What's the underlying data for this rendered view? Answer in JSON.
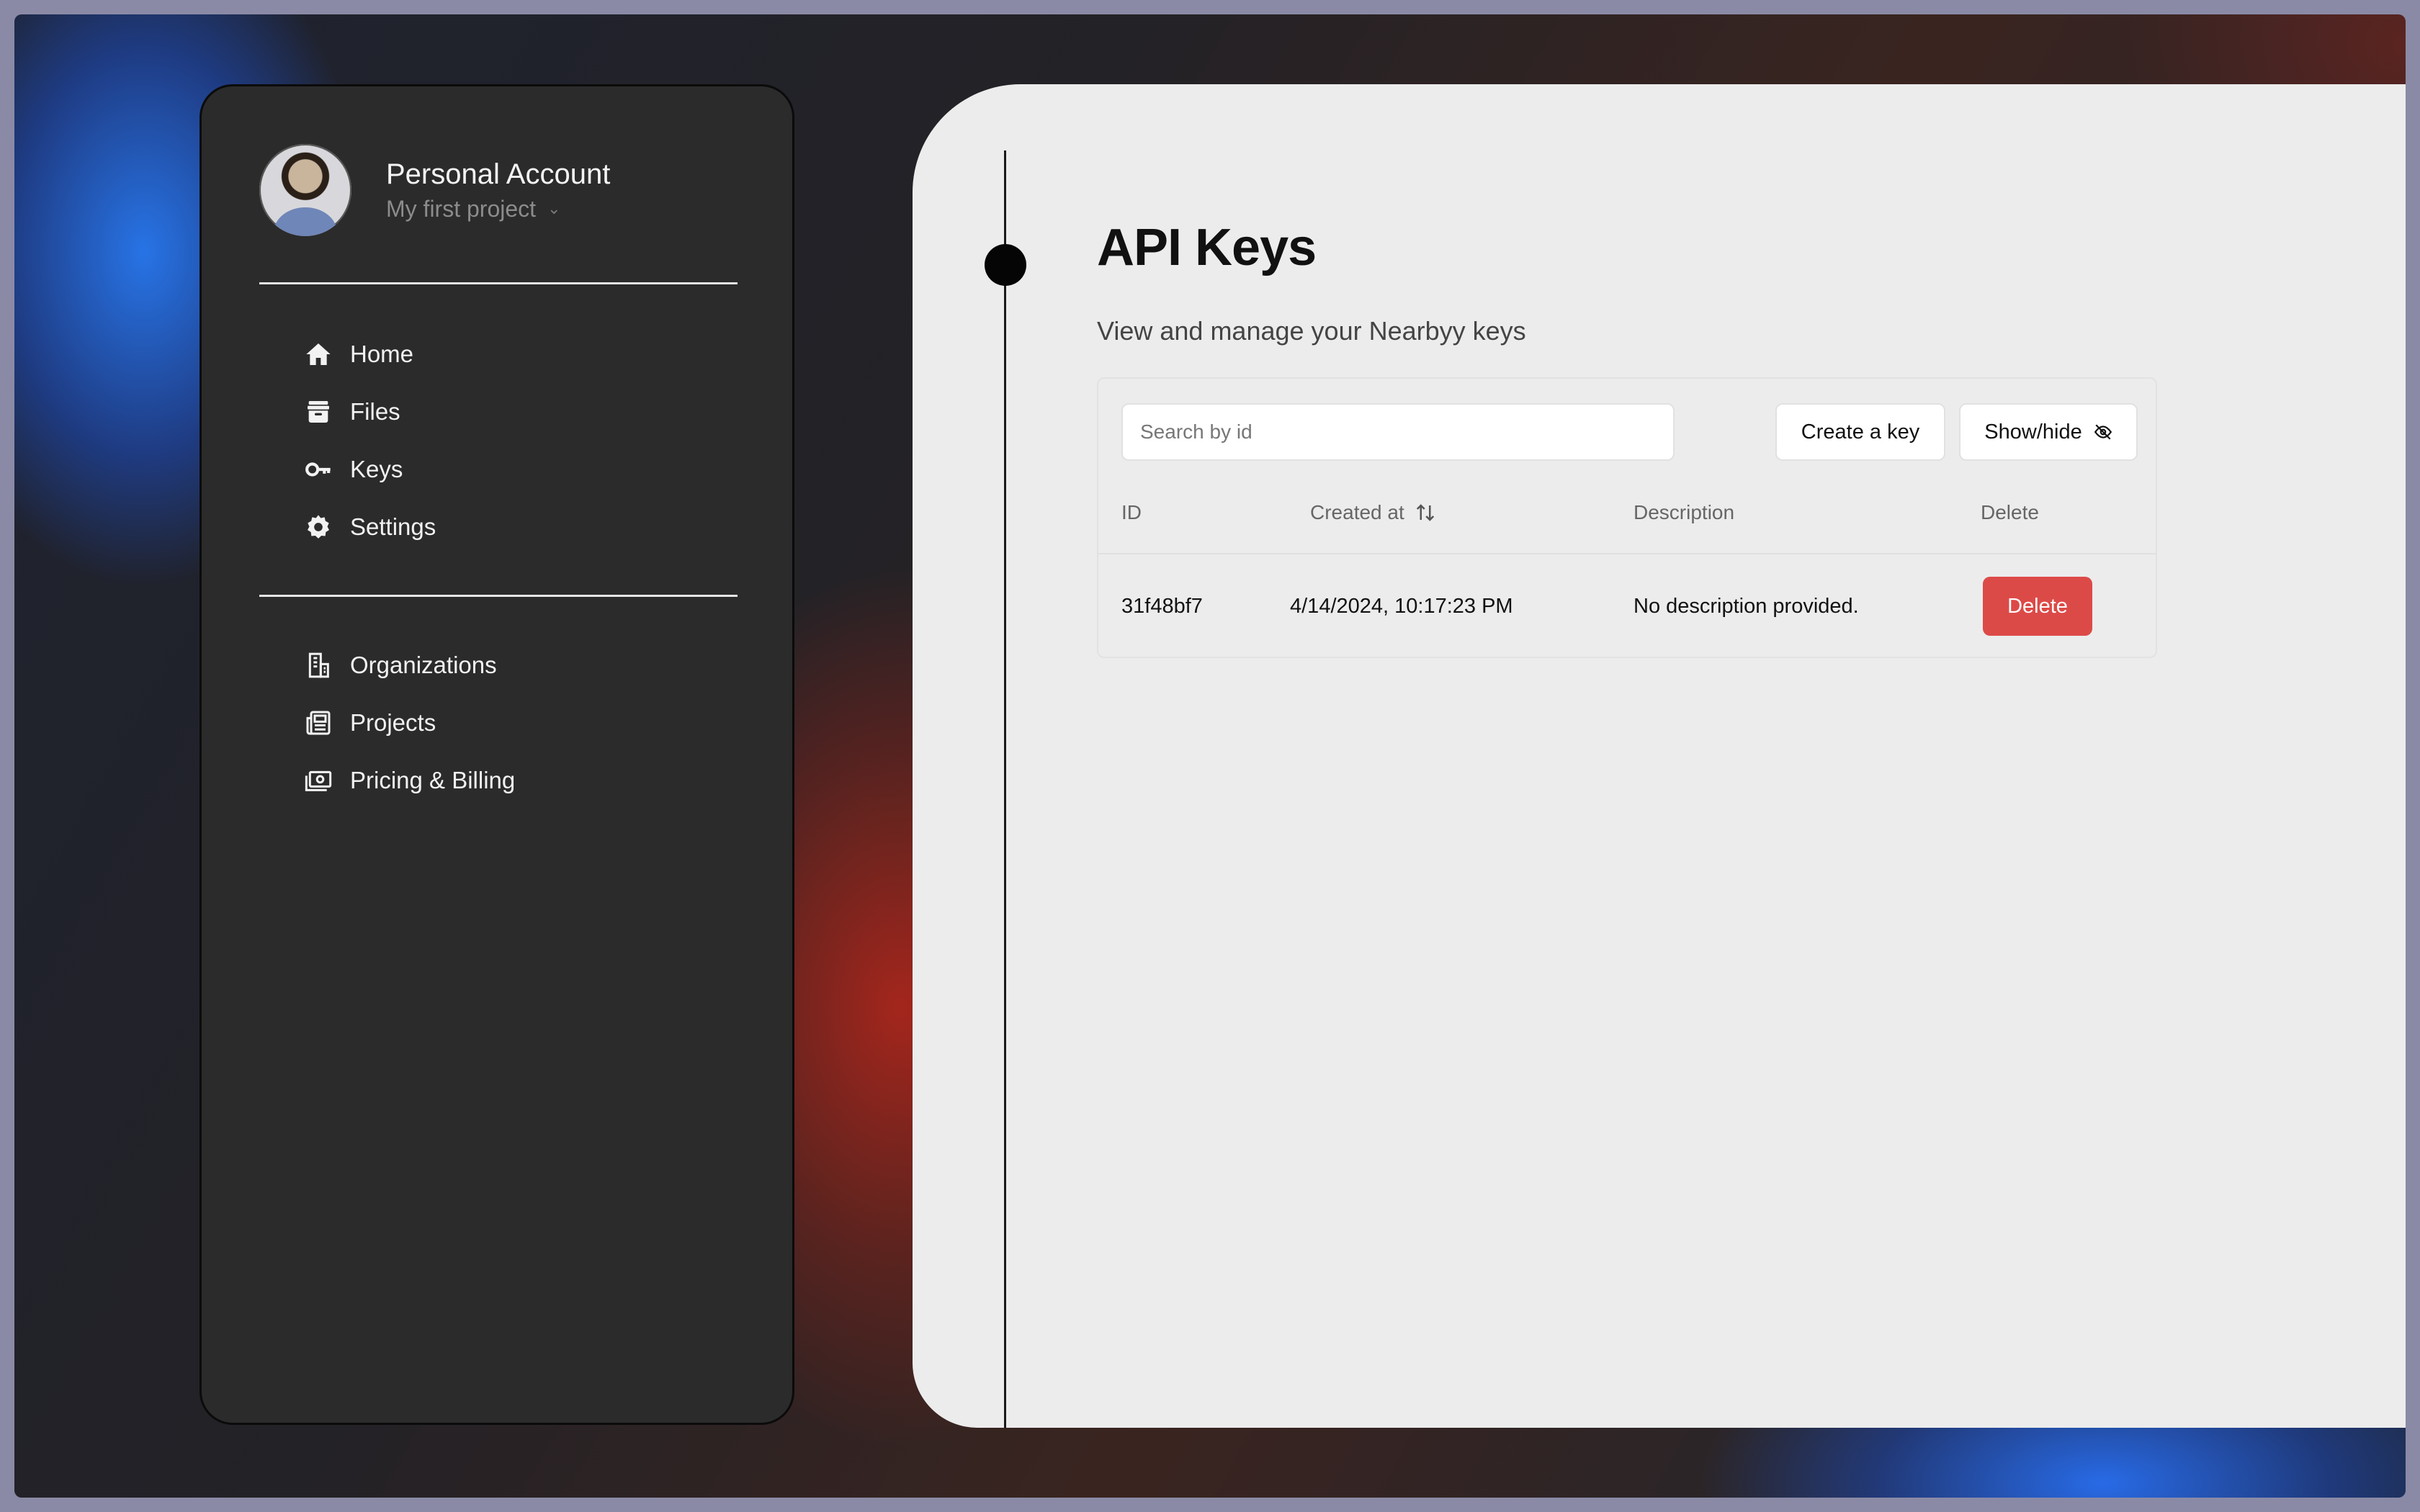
{
  "account": {
    "name": "Personal Account",
    "project": "My first project"
  },
  "sidebar": {
    "primary": [
      {
        "label": "Home",
        "icon": "home-icon"
      },
      {
        "label": "Files",
        "icon": "archive-icon"
      },
      {
        "label": "Keys",
        "icon": "key-icon"
      },
      {
        "label": "Settings",
        "icon": "gear-icon"
      }
    ],
    "secondary": [
      {
        "label": "Organizations",
        "icon": "building-icon"
      },
      {
        "label": "Projects",
        "icon": "newspaper-icon"
      },
      {
        "label": "Pricing & Billing",
        "icon": "money-icon"
      }
    ]
  },
  "page": {
    "title": "API Keys",
    "subtitle": "View and manage your Nearbyy keys"
  },
  "toolbar": {
    "search_placeholder": "Search by id",
    "create_label": "Create a key",
    "showhide_label": "Show/hide"
  },
  "table": {
    "headers": {
      "id": "ID",
      "created": "Created at",
      "description": "Description",
      "delete": "Delete"
    },
    "rows": [
      {
        "id": "31f48bf7",
        "created": "4/14/2024, 10:17:23 PM",
        "description": "No description provided.",
        "action": "Delete"
      }
    ]
  },
  "colors": {
    "sidebar_bg": "#2b2b2b",
    "main_bg": "#ececec",
    "danger": "#dc4a48"
  }
}
